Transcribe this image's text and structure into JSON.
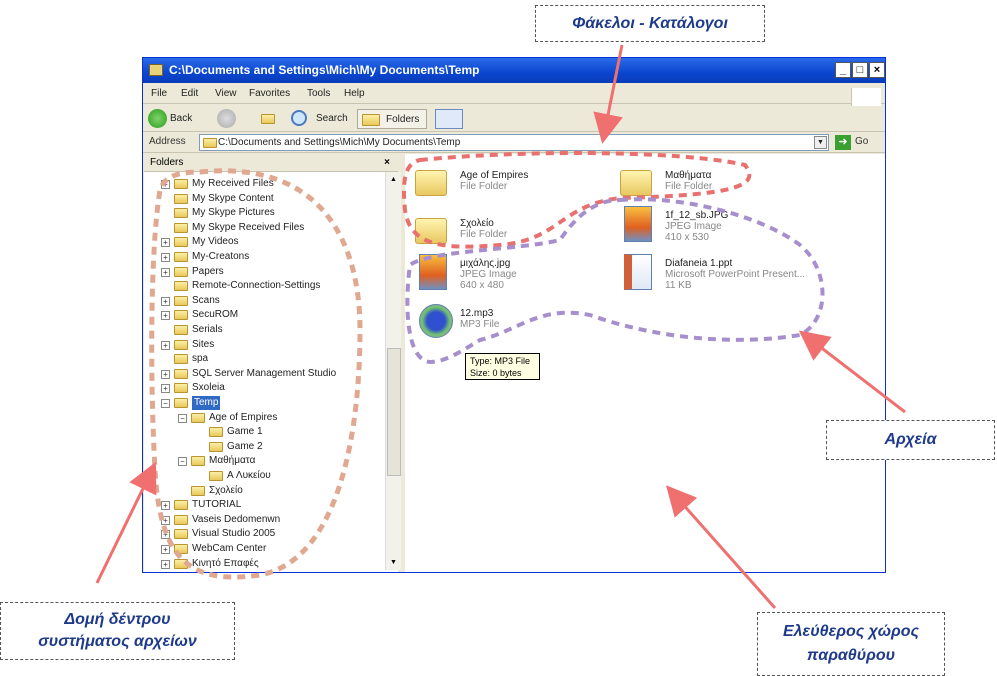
{
  "window": {
    "title": "C:\\Documents and Settings\\Mich\\My Documents\\Temp"
  },
  "menu": [
    "File",
    "Edit",
    "View",
    "Favorites",
    "Tools",
    "Help"
  ],
  "toolbar": {
    "back": "Back",
    "search": "Search",
    "folders": "Folders"
  },
  "address": {
    "label": "Address",
    "value": "C:\\Documents and Settings\\Mich\\My Documents\\Temp",
    "go": "Go"
  },
  "folders_pane": {
    "title": "Folders",
    "close": "×",
    "tree": [
      {
        "label": "My Received Files",
        "level": 0,
        "exp": "+"
      },
      {
        "label": "My Skype Content",
        "level": 0,
        "exp": ""
      },
      {
        "label": "My Skype Pictures",
        "level": 0,
        "exp": ""
      },
      {
        "label": "My Skype Received Files",
        "level": 0,
        "exp": ""
      },
      {
        "label": "My Videos",
        "level": 0,
        "exp": "+"
      },
      {
        "label": "My-Creatons",
        "level": 0,
        "exp": "+"
      },
      {
        "label": "Papers",
        "level": 0,
        "exp": "+"
      },
      {
        "label": "Remote-Connection-Settings",
        "level": 0,
        "exp": ""
      },
      {
        "label": "Scans",
        "level": 0,
        "exp": "+"
      },
      {
        "label": "SecuROM",
        "level": 0,
        "exp": "+"
      },
      {
        "label": "Serials",
        "level": 0,
        "exp": ""
      },
      {
        "label": "Sites",
        "level": 0,
        "exp": "+"
      },
      {
        "label": "spa",
        "level": 0,
        "exp": ""
      },
      {
        "label": "SQL Server Management Studio",
        "level": 0,
        "exp": "+"
      },
      {
        "label": "Sxoleia",
        "level": 0,
        "exp": "+"
      },
      {
        "label": "Temp",
        "level": 0,
        "exp": "−",
        "selected": true
      },
      {
        "label": "Age of Empires",
        "level": 1,
        "exp": "−"
      },
      {
        "label": "Game 1",
        "level": 2,
        "exp": ""
      },
      {
        "label": "Game 2",
        "level": 2,
        "exp": ""
      },
      {
        "label": "Μαθήματα",
        "level": 1,
        "exp": "−"
      },
      {
        "label": "A Λυκείου",
        "level": 2,
        "exp": ""
      },
      {
        "label": "Σχολείο",
        "level": 1,
        "exp": ""
      },
      {
        "label": "TUTORIAL",
        "level": 0,
        "exp": "+"
      },
      {
        "label": "Vaseis Dedomenwn",
        "level": 0,
        "exp": "+"
      },
      {
        "label": "Visual Studio 2005",
        "level": 0,
        "exp": "+"
      },
      {
        "label": "WebCam Center",
        "level": 0,
        "exp": "+"
      },
      {
        "label": "Κινητό Επαφές",
        "level": 0,
        "exp": "+"
      }
    ]
  },
  "files": [
    {
      "name": "Age of Empires",
      "type": "File Folder",
      "extra": "",
      "icon": "folder"
    },
    {
      "name": "Μαθήματα",
      "type": "File Folder",
      "extra": "",
      "icon": "folder"
    },
    {
      "name": "Σχολείο",
      "type": "File Folder",
      "extra": "",
      "icon": "folder"
    },
    {
      "name": "1f_12_sb.JPG",
      "type": "JPEG Image",
      "extra": "410 x 530",
      "icon": "image"
    },
    {
      "name": "μιχάλης.jpg",
      "type": "JPEG Image",
      "extra": "640 x 480",
      "icon": "image"
    },
    {
      "name": "Diafaneia 1.ppt",
      "type": "Microsoft PowerPoint Present...",
      "extra": "11 KB",
      "icon": "powerpoint"
    },
    {
      "name": "12.mp3",
      "type": "MP3 File",
      "extra": "",
      "icon": "media"
    }
  ],
  "tooltip": {
    "line1": "Type: MP3 File",
    "line2": "Size: 0 bytes"
  },
  "annotations": {
    "folders": "Φάκελοι - Κατάλογοι",
    "files": "Αρχεία",
    "tree": "Δομή δέντρου συστήματος αρχείων",
    "free_space": "Ελεύθερος χώρος παραθύρου"
  },
  "colors": {
    "folder_outline": "#e8706e",
    "file_outline": "#a68fcc",
    "tree_outline": "#e0a890",
    "arrow": "#f07070"
  }
}
